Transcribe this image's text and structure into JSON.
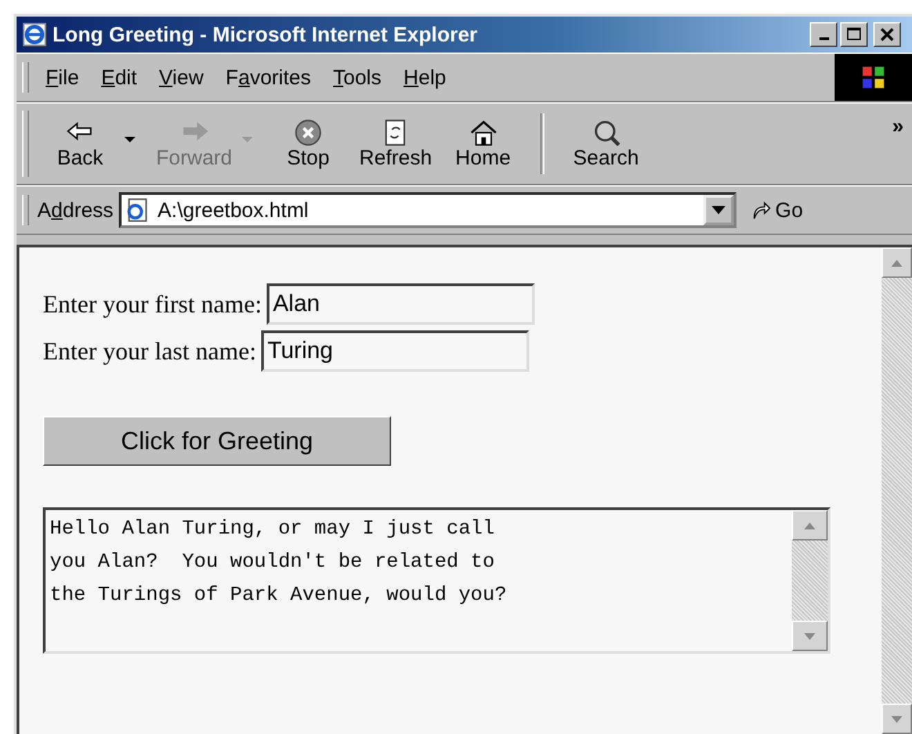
{
  "window": {
    "title": "Long Greeting - Microsoft Internet Explorer"
  },
  "menu": [
    {
      "key": "F",
      "post": "ile"
    },
    {
      "key": "E",
      "post": "dit"
    },
    {
      "key": "V",
      "post": "iew"
    },
    {
      "pre": "F",
      "key": "a",
      "post": "vorites"
    },
    {
      "key": "T",
      "post": "ools"
    },
    {
      "key": "H",
      "post": "elp"
    }
  ],
  "toolbar": [
    {
      "kind": "back",
      "label": "Back",
      "disabled": false,
      "dropdown": true
    },
    {
      "kind": "forward",
      "label": "Forward",
      "disabled": true,
      "dropdown": true
    },
    {
      "kind": "stop",
      "label": "Stop",
      "disabled": false,
      "dropdown": false
    },
    {
      "kind": "refresh",
      "label": "Refresh",
      "disabled": false,
      "dropdown": false
    },
    {
      "kind": "home",
      "label": "Home",
      "disabled": false,
      "dropdown": false
    },
    {
      "kind": "search",
      "label": "Search",
      "disabled": false,
      "dropdown": false
    }
  ],
  "overflow": "»",
  "address": {
    "label": {
      "pre": "A",
      "key": "d",
      "post": "dress"
    },
    "value": "A:\\greetbox.html",
    "go": "Go"
  },
  "page": {
    "fields": [
      {
        "label": "Enter your first name:",
        "value": "Alan"
      },
      {
        "label": "Enter your last name:",
        "value": "Turing"
      }
    ],
    "button": "Click for Greeting",
    "greeting": "Hello Alan Turing, or may I just call\nyou Alan?  You wouldn't be related to\nthe Turings of Park Avenue, would you?"
  }
}
